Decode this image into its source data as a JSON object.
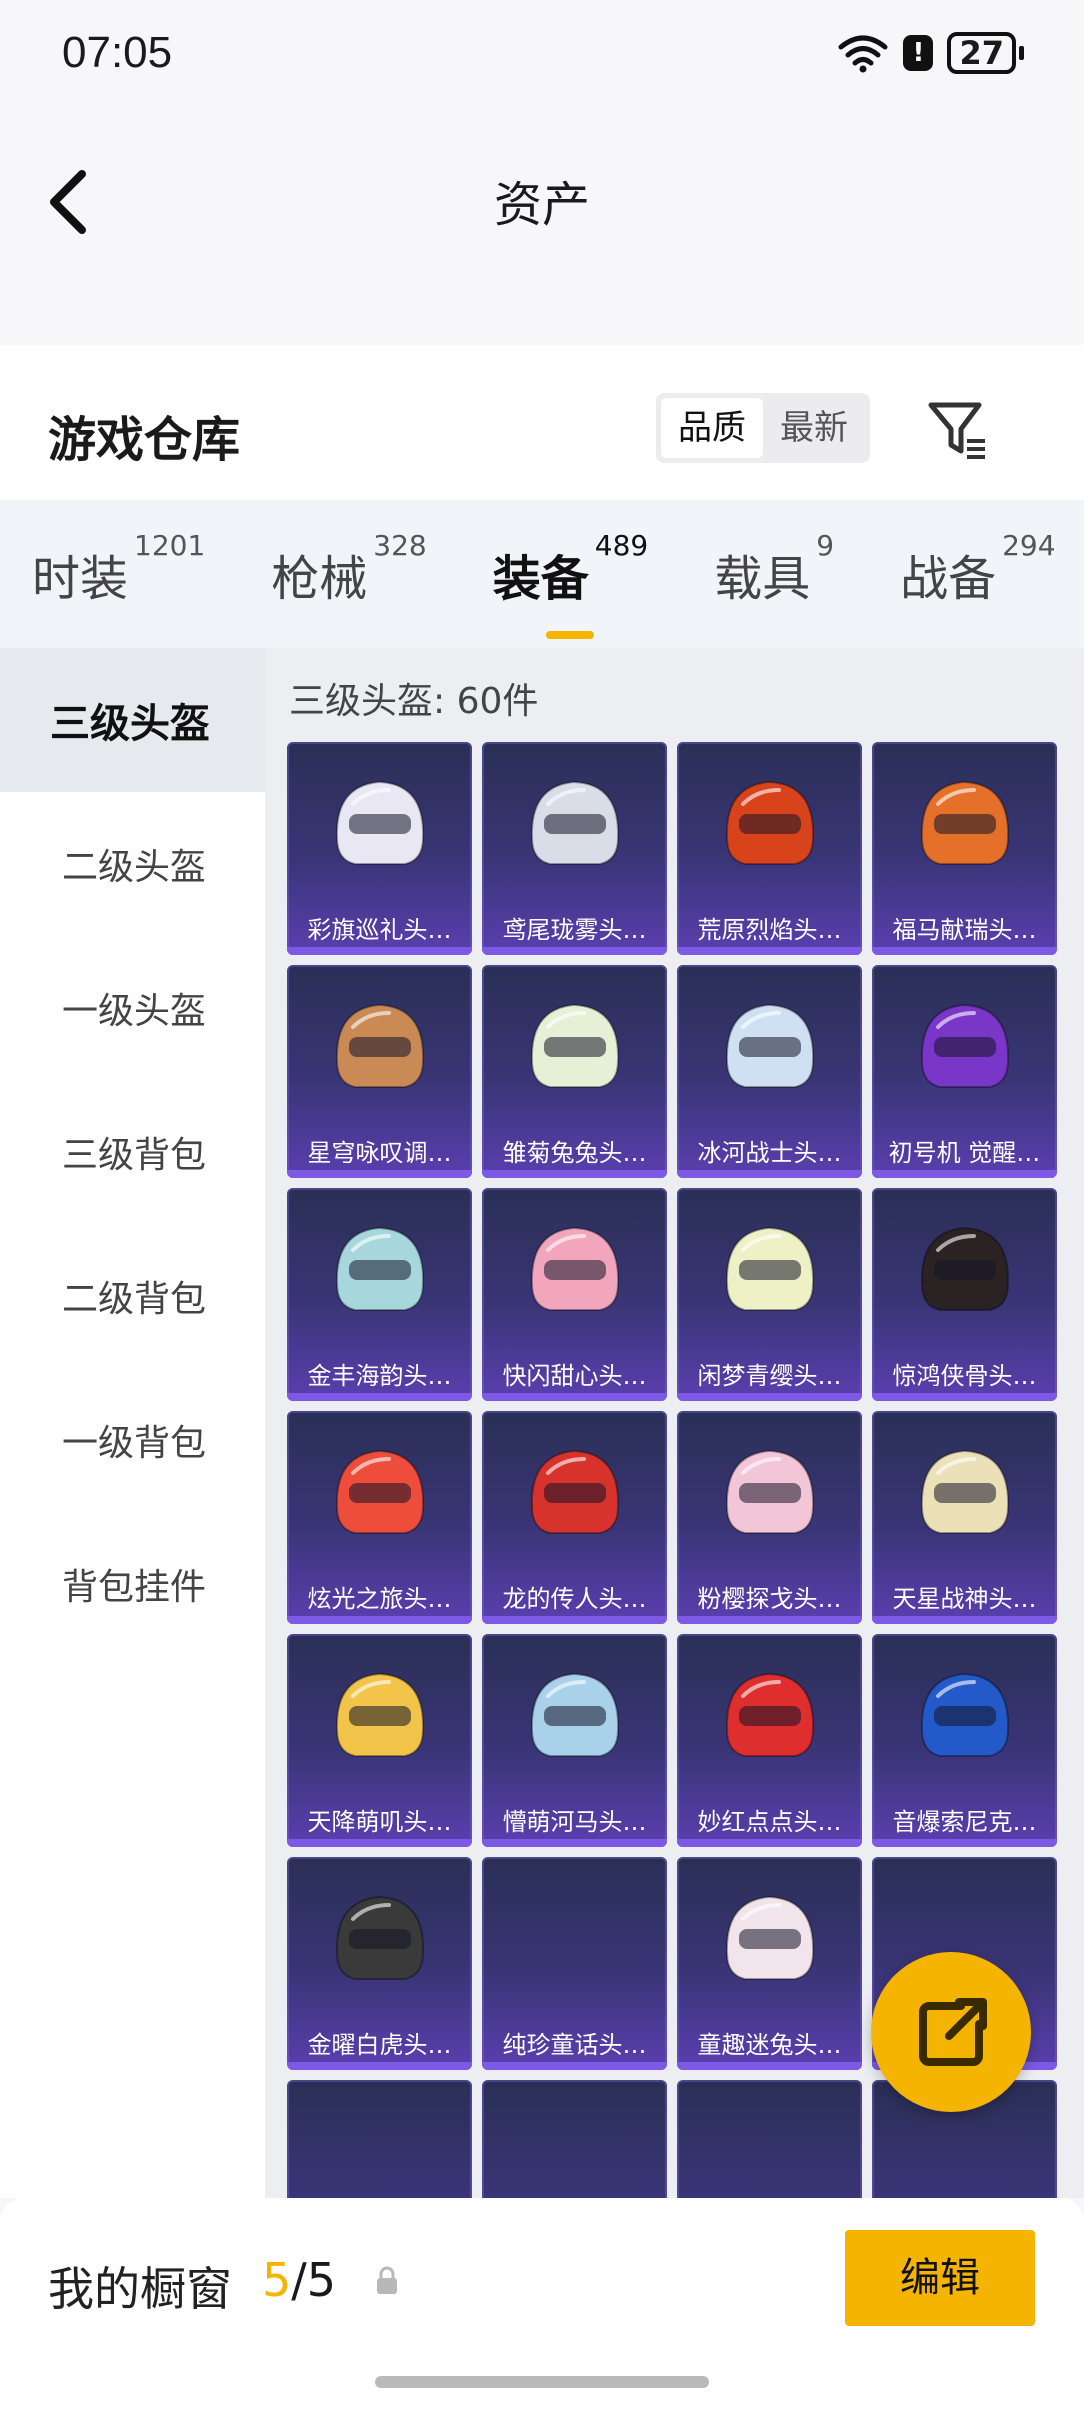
{
  "status_bar": {
    "time": "07:05",
    "battery": "27"
  },
  "header": {
    "title": "资产"
  },
  "warehouse": {
    "title": "游戏仓库",
    "sort_options": [
      {
        "label": "品质",
        "active": true
      },
      {
        "label": "最新",
        "active": false
      }
    ]
  },
  "categories": [
    {
      "label": "时装",
      "count": "1201",
      "active": false
    },
    {
      "label": "枪械",
      "count": "328",
      "active": false
    },
    {
      "label": "装备",
      "count": "489",
      "active": true
    },
    {
      "label": "载具",
      "count": "9",
      "active": false
    },
    {
      "label": "战备",
      "count": "294",
      "active": false
    }
  ],
  "side_nav": [
    {
      "label": "三级头盔",
      "active": true
    },
    {
      "label": "二级头盔",
      "active": false
    },
    {
      "label": "一级头盔",
      "active": false
    },
    {
      "label": "三级背包",
      "active": false
    },
    {
      "label": "二级背包",
      "active": false
    },
    {
      "label": "一级背包",
      "active": false
    },
    {
      "label": "背包挂件",
      "active": false
    }
  ],
  "content": {
    "count_label": "三级头盔: 60件",
    "items": [
      {
        "name": "彩旗巡礼头…",
        "color": "#e9e7f4"
      },
      {
        "name": "鸢尾珑雾头…",
        "color": "#d9dde8"
      },
      {
        "name": "荒原烈焰头…",
        "color": "#d9431c"
      },
      {
        "name": "福马献瑞头…",
        "color": "#e5702a"
      },
      {
        "name": "星穹咏叹调…",
        "color": "#c98a55"
      },
      {
        "name": "雏菊兔兔头…",
        "color": "#e6f0d6"
      },
      {
        "name": "冰河战士头…",
        "color": "#cfe0f2"
      },
      {
        "name": "初号机 觉醒…",
        "color": "#7a36c8"
      },
      {
        "name": "金丰海韵头…",
        "color": "#a7d7dd"
      },
      {
        "name": "快闪甜心头…",
        "color": "#f2a6bd"
      },
      {
        "name": "闲梦青缨头…",
        "color": "#eef0c6"
      },
      {
        "name": "惊鸿侠骨头…",
        "color": "#2b2224"
      },
      {
        "name": "炫光之旅头…",
        "color": "#ee4d3c"
      },
      {
        "name": "龙的传人头…",
        "color": "#d8322d"
      },
      {
        "name": "粉樱探戈头…",
        "color": "#f2c6d6"
      },
      {
        "name": "天星战神头…",
        "color": "#ece0b8"
      },
      {
        "name": "天降萌叽头…",
        "color": "#f2c44a"
      },
      {
        "name": "懵萌河马头…",
        "color": "#a9d1ea"
      },
      {
        "name": "妙红点点头…",
        "color": "#df2e2e"
      },
      {
        "name": "音爆索尼克…",
        "color": "#2459c9"
      },
      {
        "name": "金曜白虎头…",
        "color": "#3a3a3a"
      },
      {
        "name": "纯珍童话头…",
        "color": ""
      },
      {
        "name": "童趣迷兔头…",
        "color": "#f1e4ea"
      },
      {
        "name": "",
        "color": ""
      },
      {
        "name": "",
        "color": ""
      },
      {
        "name": "",
        "color": ""
      },
      {
        "name": "",
        "color": ""
      },
      {
        "name": "",
        "color": ""
      }
    ]
  },
  "bottom_bar": {
    "showcase_label": "我的橱窗",
    "showcase_current": "5",
    "showcase_total": "/5",
    "edit_label": "编辑"
  }
}
